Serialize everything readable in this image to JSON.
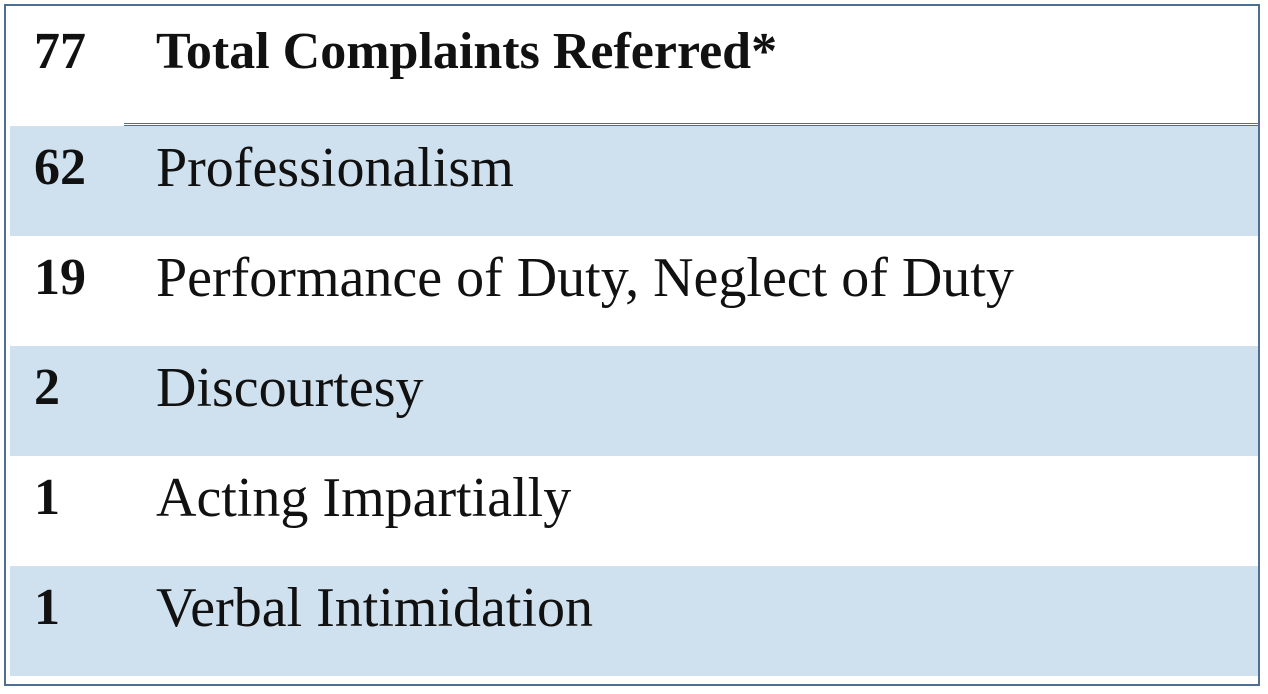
{
  "table": {
    "header": {
      "count": "77",
      "label": "Total Complaints Referred*"
    },
    "rows": [
      {
        "count": "62",
        "label": "Professionalism"
      },
      {
        "count": "19",
        "label": "Performance of Duty, Neglect of Duty"
      },
      {
        "count": "2",
        "label": "Discourtesy"
      },
      {
        "count": "1",
        "label": "Acting Impartially"
      },
      {
        "count": "1",
        "label": "Verbal Intimidation"
      }
    ]
  },
  "colors": {
    "shaded_row": "#cfe0ee",
    "border": "#4f6f91",
    "text": "#111111"
  }
}
